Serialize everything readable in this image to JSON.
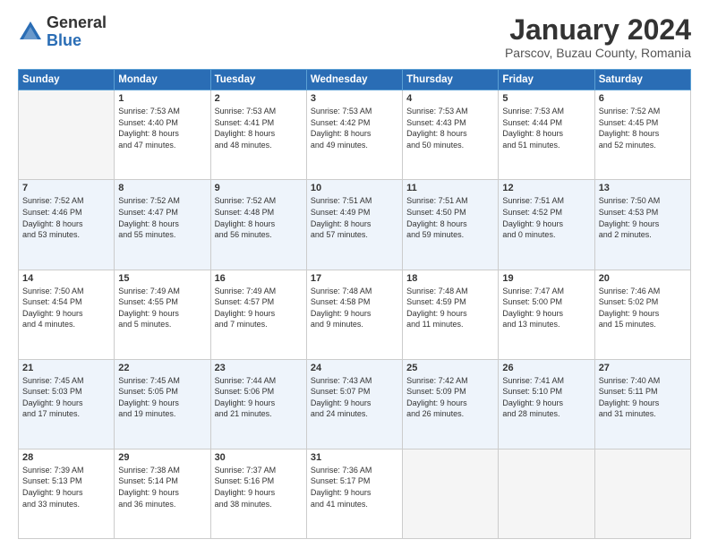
{
  "header": {
    "logo_general": "General",
    "logo_blue": "Blue",
    "title": "January 2024",
    "location": "Parscov, Buzau County, Romania"
  },
  "days_of_week": [
    "Sunday",
    "Monday",
    "Tuesday",
    "Wednesday",
    "Thursday",
    "Friday",
    "Saturday"
  ],
  "weeks": [
    [
      {
        "day": "",
        "sunrise": "",
        "sunset": "",
        "daylight": ""
      },
      {
        "day": "1",
        "sunrise": "Sunrise: 7:53 AM",
        "sunset": "Sunset: 4:40 PM",
        "daylight": "Daylight: 8 hours and 47 minutes."
      },
      {
        "day": "2",
        "sunrise": "Sunrise: 7:53 AM",
        "sunset": "Sunset: 4:41 PM",
        "daylight": "Daylight: 8 hours and 48 minutes."
      },
      {
        "day": "3",
        "sunrise": "Sunrise: 7:53 AM",
        "sunset": "Sunset: 4:42 PM",
        "daylight": "Daylight: 8 hours and 49 minutes."
      },
      {
        "day": "4",
        "sunrise": "Sunrise: 7:53 AM",
        "sunset": "Sunset: 4:43 PM",
        "daylight": "Daylight: 8 hours and 50 minutes."
      },
      {
        "day": "5",
        "sunrise": "Sunrise: 7:53 AM",
        "sunset": "Sunset: 4:44 PM",
        "daylight": "Daylight: 8 hours and 51 minutes."
      },
      {
        "day": "6",
        "sunrise": "Sunrise: 7:52 AM",
        "sunset": "Sunset: 4:45 PM",
        "daylight": "Daylight: 8 hours and 52 minutes."
      }
    ],
    [
      {
        "day": "7",
        "sunrise": "Sunrise: 7:52 AM",
        "sunset": "Sunset: 4:46 PM",
        "daylight": "Daylight: 8 hours and 53 minutes."
      },
      {
        "day": "8",
        "sunrise": "Sunrise: 7:52 AM",
        "sunset": "Sunset: 4:47 PM",
        "daylight": "Daylight: 8 hours and 55 minutes."
      },
      {
        "day": "9",
        "sunrise": "Sunrise: 7:52 AM",
        "sunset": "Sunset: 4:48 PM",
        "daylight": "Daylight: 8 hours and 56 minutes."
      },
      {
        "day": "10",
        "sunrise": "Sunrise: 7:51 AM",
        "sunset": "Sunset: 4:49 PM",
        "daylight": "Daylight: 8 hours and 57 minutes."
      },
      {
        "day": "11",
        "sunrise": "Sunrise: 7:51 AM",
        "sunset": "Sunset: 4:50 PM",
        "daylight": "Daylight: 8 hours and 59 minutes."
      },
      {
        "day": "12",
        "sunrise": "Sunrise: 7:51 AM",
        "sunset": "Sunset: 4:52 PM",
        "daylight": "Daylight: 9 hours and 0 minutes."
      },
      {
        "day": "13",
        "sunrise": "Sunrise: 7:50 AM",
        "sunset": "Sunset: 4:53 PM",
        "daylight": "Daylight: 9 hours and 2 minutes."
      }
    ],
    [
      {
        "day": "14",
        "sunrise": "Sunrise: 7:50 AM",
        "sunset": "Sunset: 4:54 PM",
        "daylight": "Daylight: 9 hours and 4 minutes."
      },
      {
        "day": "15",
        "sunrise": "Sunrise: 7:49 AM",
        "sunset": "Sunset: 4:55 PM",
        "daylight": "Daylight: 9 hours and 5 minutes."
      },
      {
        "day": "16",
        "sunrise": "Sunrise: 7:49 AM",
        "sunset": "Sunset: 4:57 PM",
        "daylight": "Daylight: 9 hours and 7 minutes."
      },
      {
        "day": "17",
        "sunrise": "Sunrise: 7:48 AM",
        "sunset": "Sunset: 4:58 PM",
        "daylight": "Daylight: 9 hours and 9 minutes."
      },
      {
        "day": "18",
        "sunrise": "Sunrise: 7:48 AM",
        "sunset": "Sunset: 4:59 PM",
        "daylight": "Daylight: 9 hours and 11 minutes."
      },
      {
        "day": "19",
        "sunrise": "Sunrise: 7:47 AM",
        "sunset": "Sunset: 5:00 PM",
        "daylight": "Daylight: 9 hours and 13 minutes."
      },
      {
        "day": "20",
        "sunrise": "Sunrise: 7:46 AM",
        "sunset": "Sunset: 5:02 PM",
        "daylight": "Daylight: 9 hours and 15 minutes."
      }
    ],
    [
      {
        "day": "21",
        "sunrise": "Sunrise: 7:45 AM",
        "sunset": "Sunset: 5:03 PM",
        "daylight": "Daylight: 9 hours and 17 minutes."
      },
      {
        "day": "22",
        "sunrise": "Sunrise: 7:45 AM",
        "sunset": "Sunset: 5:05 PM",
        "daylight": "Daylight: 9 hours and 19 minutes."
      },
      {
        "day": "23",
        "sunrise": "Sunrise: 7:44 AM",
        "sunset": "Sunset: 5:06 PM",
        "daylight": "Daylight: 9 hours and 21 minutes."
      },
      {
        "day": "24",
        "sunrise": "Sunrise: 7:43 AM",
        "sunset": "Sunset: 5:07 PM",
        "daylight": "Daylight: 9 hours and 24 minutes."
      },
      {
        "day": "25",
        "sunrise": "Sunrise: 7:42 AM",
        "sunset": "Sunset: 5:09 PM",
        "daylight": "Daylight: 9 hours and 26 minutes."
      },
      {
        "day": "26",
        "sunrise": "Sunrise: 7:41 AM",
        "sunset": "Sunset: 5:10 PM",
        "daylight": "Daylight: 9 hours and 28 minutes."
      },
      {
        "day": "27",
        "sunrise": "Sunrise: 7:40 AM",
        "sunset": "Sunset: 5:11 PM",
        "daylight": "Daylight: 9 hours and 31 minutes."
      }
    ],
    [
      {
        "day": "28",
        "sunrise": "Sunrise: 7:39 AM",
        "sunset": "Sunset: 5:13 PM",
        "daylight": "Daylight: 9 hours and 33 minutes."
      },
      {
        "day": "29",
        "sunrise": "Sunrise: 7:38 AM",
        "sunset": "Sunset: 5:14 PM",
        "daylight": "Daylight: 9 hours and 36 minutes."
      },
      {
        "day": "30",
        "sunrise": "Sunrise: 7:37 AM",
        "sunset": "Sunset: 5:16 PM",
        "daylight": "Daylight: 9 hours and 38 minutes."
      },
      {
        "day": "31",
        "sunrise": "Sunrise: 7:36 AM",
        "sunset": "Sunset: 5:17 PM",
        "daylight": "Daylight: 9 hours and 41 minutes."
      },
      {
        "day": "",
        "sunrise": "",
        "sunset": "",
        "daylight": ""
      },
      {
        "day": "",
        "sunrise": "",
        "sunset": "",
        "daylight": ""
      },
      {
        "day": "",
        "sunrise": "",
        "sunset": "",
        "daylight": ""
      }
    ]
  ]
}
